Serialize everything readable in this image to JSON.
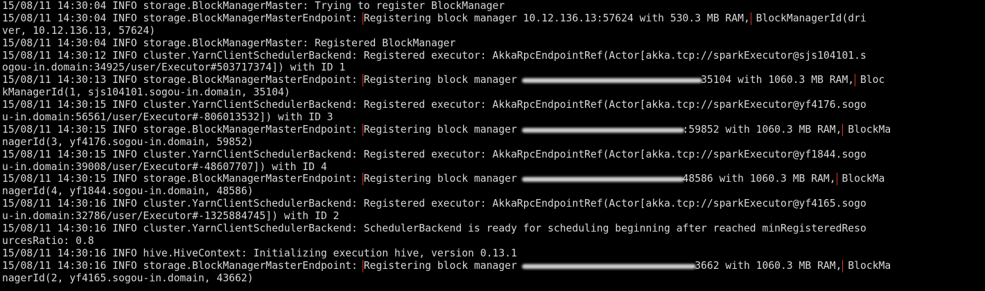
{
  "terminal": {
    "rows": [
      {
        "parts": [
          {
            "t": "15/08/11 14:30:04 INFO storage.BlockManagerMaster: Trying to register BlockManager"
          }
        ]
      },
      {
        "parts": [
          {
            "t": "15/08/11 14:30:04 INFO storage.BlockManagerMasterEndpoint: "
          },
          {
            "t": "Registering block manager 10.12.136.13:57624 with 530.3 MB RAM,",
            "hl": true
          },
          {
            "t": " BlockManagerId(dri"
          }
        ]
      },
      {
        "parts": [
          {
            "t": "ver, 10.12.136.13, 57624)"
          }
        ]
      },
      {
        "parts": [
          {
            "t": "15/08/11 14:30:04 INFO storage.BlockManagerMaster: Registered BlockManager"
          }
        ]
      },
      {
        "parts": [
          {
            "t": "15/08/11 14:30:12 INFO cluster.YarnClientSchedulerBackend: Registered executor: AkkaRpcEndpointRef(Actor[akka.tcp://sparkExecutor@sjs104101.s"
          }
        ]
      },
      {
        "parts": [
          {
            "t": "ogou-in.domain:34925/user/Executor#503717374]) with ID 1"
          }
        ]
      },
      {
        "parts": [
          {
            "t": "15/08/11 14:30:13 INFO storage.BlockManagerMasterEndpoint: "
          },
          {
            "t": "Registering block manager ",
            "hl": "start"
          },
          {
            "redact": 29
          },
          {
            "t": "35104 with 1060.3 MB RAM,",
            "hl": "end"
          },
          {
            "t": " Bloc"
          }
        ]
      },
      {
        "parts": [
          {
            "t": "kManagerId(1, sjs104101.sogou-in.domain, 35104)"
          }
        ]
      },
      {
        "parts": [
          {
            "t": "15/08/11 14:30:15 INFO cluster.YarnClientSchedulerBackend: Registered executor: AkkaRpcEndpointRef(Actor[akka.tcp://sparkExecutor@yf4176.sogo"
          }
        ]
      },
      {
        "parts": [
          {
            "t": "u-in.domain:56561/user/Executor#-806013532]) with ID 3"
          }
        ]
      },
      {
        "parts": [
          {
            "t": "15/08/11 14:30:15 INFO storage.BlockManagerMasterEndpoint: "
          },
          {
            "t": "Registering block manager ",
            "hl": "start"
          },
          {
            "redact": 26
          },
          {
            "t": ":59852 with 1060.3 MB RAM,",
            "hl": "end"
          },
          {
            "t": " BlockMa"
          }
        ]
      },
      {
        "parts": [
          {
            "t": "nagerId(3, yf4176.sogou-in.domain, 59852)"
          }
        ]
      },
      {
        "parts": [
          {
            "t": "15/08/11 14:30:15 INFO cluster.YarnClientSchedulerBackend: Registered executor: AkkaRpcEndpointRef(Actor[akka.tcp://sparkExecutor@yf1844.sogo"
          }
        ]
      },
      {
        "parts": [
          {
            "t": "u-in.domain:39008/user/Executor#-48607707]) with ID 4"
          }
        ]
      },
      {
        "parts": [
          {
            "t": "15/08/11 14:30:15 INFO storage.BlockManagerMasterEndpoint: "
          },
          {
            "t": "Registering block manager ",
            "hl": "start"
          },
          {
            "redact": 26
          },
          {
            "t": "48586 with 1060.3 MB RAM,",
            "hl": "end"
          },
          {
            "t": " BlockMa"
          }
        ]
      },
      {
        "parts": [
          {
            "t": "nagerId(4, yf1844.sogou-in.domain, 48586)"
          }
        ]
      },
      {
        "parts": [
          {
            "t": "15/08/11 14:30:16 INFO cluster.YarnClientSchedulerBackend: Registered executor: AkkaRpcEndpointRef(Actor[akka.tcp://sparkExecutor@yf4165.sogo"
          }
        ]
      },
      {
        "parts": [
          {
            "t": "u-in.domain:32786/user/Executor#-1325884745]) with ID 2"
          }
        ]
      },
      {
        "parts": [
          {
            "t": "15/08/11 14:30:16 INFO cluster.YarnClientSchedulerBackend: SchedulerBackend is ready for scheduling beginning after reached minRegisteredReso"
          }
        ]
      },
      {
        "parts": [
          {
            "t": "urcesRatio: 0.8"
          }
        ]
      },
      {
        "parts": [
          {
            "t": "15/08/11 14:30:16 INFO hive.HiveContext: Initializing execution hive, version 0.13.1"
          }
        ]
      },
      {
        "parts": [
          {
            "t": "15/08/11 14:30:16 INFO storage.BlockManagerMasterEndpoint: "
          },
          {
            "t": "Registering block manager ",
            "hl": "start"
          },
          {
            "redact": 28
          },
          {
            "t": "3662 with 1060.3 MB RAM,",
            "hl": "end"
          },
          {
            "t": " BlockMa"
          }
        ]
      },
      {
        "parts": [
          {
            "t": "nagerId(2, yf4165.sogou-in.domain, 43662)"
          }
        ]
      }
    ]
  },
  "colors": {
    "background": "#000000",
    "text": "#d9d9d9",
    "highlight_box": "#e0392b"
  }
}
